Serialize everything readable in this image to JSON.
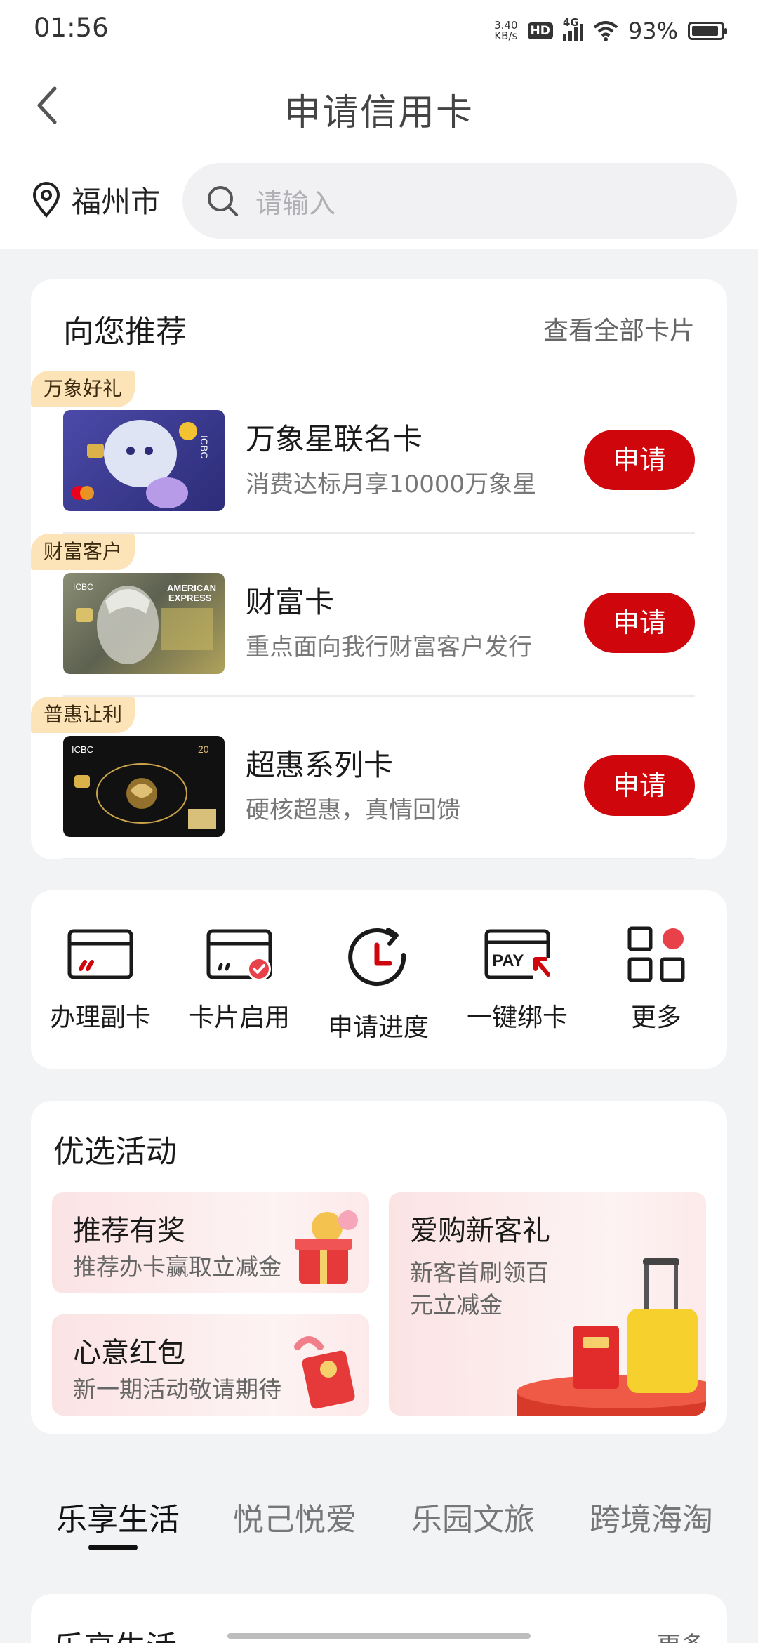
{
  "status_bar": {
    "time": "01:56",
    "speed_value": "3.40",
    "speed_unit": "KB/s",
    "hd": "HD",
    "network": "4G",
    "battery": "93%",
    "battery_level": 0.93
  },
  "header": {
    "title": "申请信用卡"
  },
  "location": {
    "city": "福州市"
  },
  "search": {
    "placeholder": "请输入"
  },
  "recommend": {
    "title": "向您推荐",
    "more": "查看全部卡片",
    "apply_label": "申请",
    "items": [
      {
        "tag": "万象好礼",
        "name": "万象星联名卡",
        "desc": "消费达标月享10000万象星"
      },
      {
        "tag": "财富客户",
        "name": "财富卡",
        "desc": "重点面向我行财富客户发行"
      },
      {
        "tag": "普惠让利",
        "name": "超惠系列卡",
        "desc": "硬核超惠，真情回馈"
      }
    ]
  },
  "quick_actions": [
    {
      "label": "办理副卡",
      "icon": "card-icon"
    },
    {
      "label": "卡片启用",
      "icon": "card-check-icon"
    },
    {
      "label": "申请进度",
      "icon": "refresh-clock-icon"
    },
    {
      "label": "一键绑卡",
      "icon": "pay-bind-icon"
    },
    {
      "label": "更多",
      "icon": "grid-more-icon"
    }
  ],
  "activities": {
    "title": "优选活动",
    "tiles": [
      {
        "title": "推荐有奖",
        "subtitle": "推荐办卡赢取立减金"
      },
      {
        "title": "心意红包",
        "subtitle": "新一期活动敬请期待"
      },
      {
        "title": "爱购新客礼",
        "subtitle": "新客首刷领百元立减金"
      }
    ]
  },
  "tabs": [
    {
      "label": "乐享生活",
      "active": true
    },
    {
      "label": "悦己悦爱",
      "active": false
    },
    {
      "label": "乐园文旅",
      "active": false
    },
    {
      "label": "跨境海淘",
      "active": false
    }
  ],
  "section": {
    "title": "乐享生活",
    "more": "更多"
  },
  "colors": {
    "accent": "#d0060d",
    "tag_bg": "#fde3b8",
    "page_bg": "#f2f3f5"
  }
}
